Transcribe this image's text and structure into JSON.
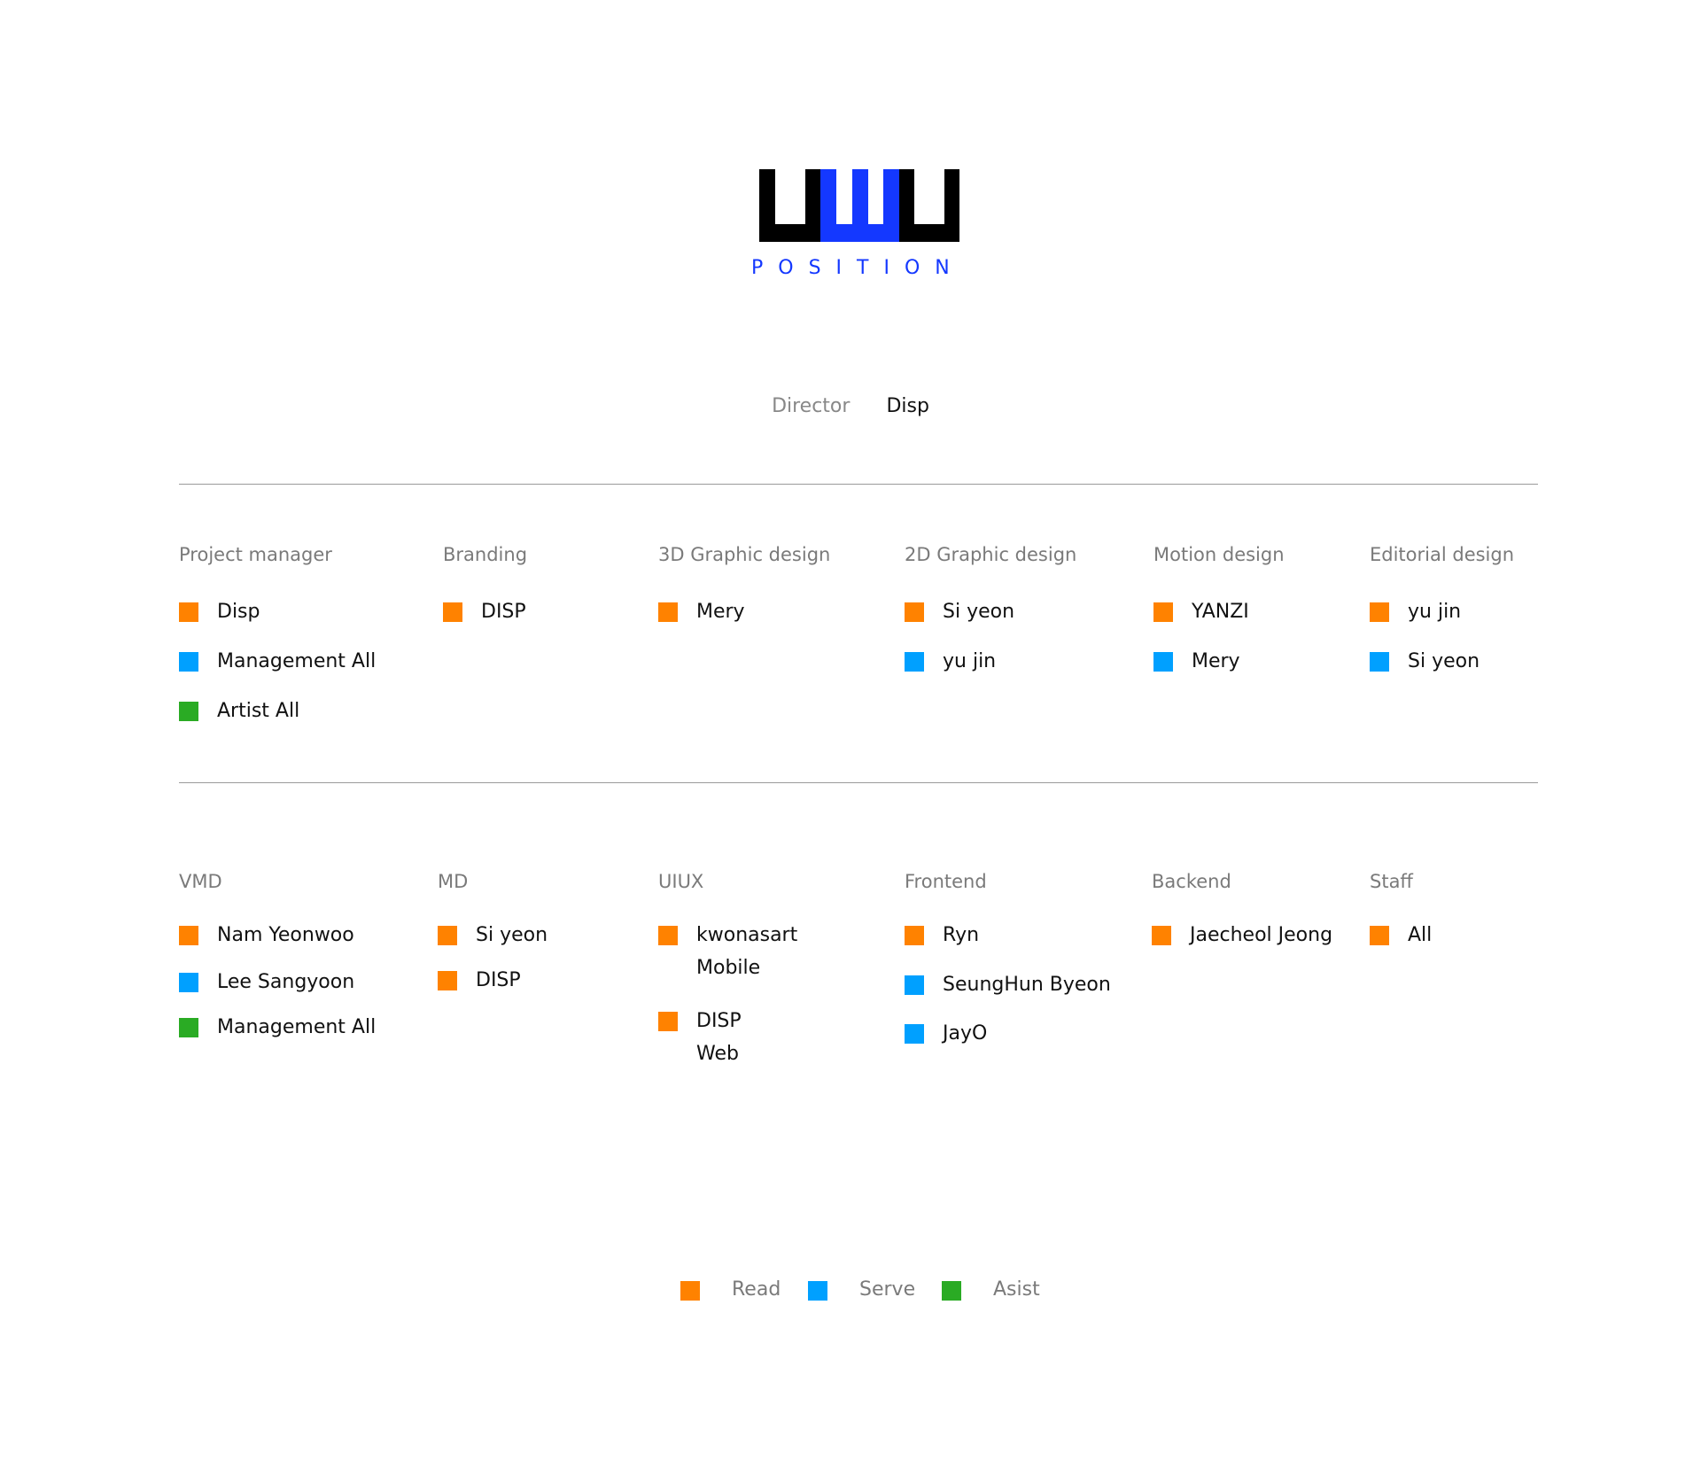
{
  "brand": {
    "logo_icon": "www-bars-logo",
    "position_label": "POSITION"
  },
  "director": {
    "label": "Director",
    "name": "Disp"
  },
  "colors": {
    "read": "#ff8200",
    "serve": "#00a0ff",
    "asist": "#2aab24",
    "logo_black": "#000000",
    "logo_blue": "#1438ff"
  },
  "row1": [
    {
      "title": "Project manager",
      "entries": [
        {
          "name": "Disp",
          "role": "read"
        },
        {
          "name": "Management All",
          "role": "serve"
        },
        {
          "name": "Artist All",
          "role": "asist"
        }
      ]
    },
    {
      "title": "Branding",
      "entries": [
        {
          "name": "DISP",
          "role": "read"
        }
      ]
    },
    {
      "title": "3D Graphic design",
      "entries": [
        {
          "name": "Mery",
          "role": "read"
        }
      ]
    },
    {
      "title": "2D Graphic design",
      "entries": [
        {
          "name": "Si yeon",
          "role": "read"
        },
        {
          "name": "yu jin",
          "role": "serve"
        }
      ]
    },
    {
      "title": "Motion design",
      "entries": [
        {
          "name": "YANZI",
          "role": "read"
        },
        {
          "name": "Mery",
          "role": "serve"
        }
      ]
    },
    {
      "title": "Editorial design",
      "entries": [
        {
          "name": "yu jin",
          "role": "read"
        },
        {
          "name": "Si yeon",
          "role": "serve"
        }
      ]
    }
  ],
  "row2": [
    {
      "title": "VMD",
      "entries": [
        {
          "name": "Nam Yeonwoo",
          "role": "read"
        },
        {
          "name": "Lee Sangyoon",
          "role": "serve"
        },
        {
          "name": "Management All",
          "role": "asist"
        }
      ]
    },
    {
      "title": "MD",
      "entries": [
        {
          "name": "Si yeon",
          "role": "read"
        },
        {
          "name": "DISP",
          "role": "read"
        }
      ]
    },
    {
      "title": "UIUX",
      "entries": [
        {
          "name": "kwonasart",
          "sub": "Mobile",
          "role": "read"
        },
        {
          "name": "DISP",
          "sub": "Web",
          "role": "read"
        }
      ]
    },
    {
      "title": "Frontend",
      "entries": [
        {
          "name": "Ryn",
          "role": "read"
        },
        {
          "name": "SeungHun Byeon",
          "role": "serve"
        },
        {
          "name": "JayO",
          "role": "serve"
        }
      ]
    },
    {
      "title": "Backend",
      "entries": [
        {
          "name": "Jaecheol Jeong",
          "role": "read"
        }
      ]
    },
    {
      "title": "Staff",
      "entries": [
        {
          "name": "All",
          "role": "read"
        }
      ]
    }
  ],
  "legend": [
    {
      "label": "Read",
      "role": "read"
    },
    {
      "label": "Serve",
      "role": "serve"
    },
    {
      "label": "Asist",
      "role": "asist"
    }
  ]
}
